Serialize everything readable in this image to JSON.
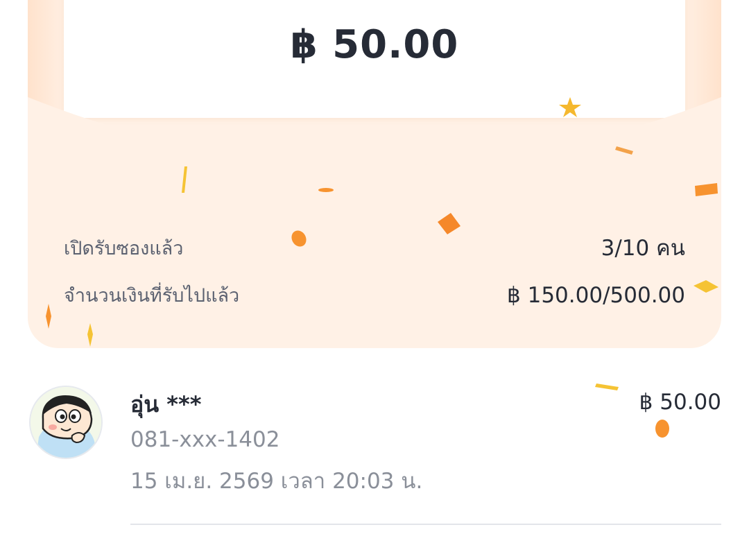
{
  "envelope": {
    "amount": "฿ 50.00",
    "stats": [
      {
        "label": "เปิดรับซองแล้ว",
        "value": "3/10 คน"
      },
      {
        "label": "จำนวนเงินที่รับไปแล้ว",
        "value": "฿ 150.00/500.00"
      }
    ]
  },
  "recipients": [
    {
      "name": "อุ่น ***",
      "phone": "081-xxx-1402",
      "datetime": "15 เม.ย. 2569 เวลา 20:03 น.",
      "amount": "฿ 50.00",
      "avatar_icon": "cartoon-boy-avatar-icon"
    }
  ],
  "colors": {
    "envelope_bg": "#fff1e6",
    "confetti_orange": "#f7932f",
    "confetti_yellow": "#f5c334",
    "text_dark": "#262b36",
    "text_muted": "#8a8f99"
  }
}
